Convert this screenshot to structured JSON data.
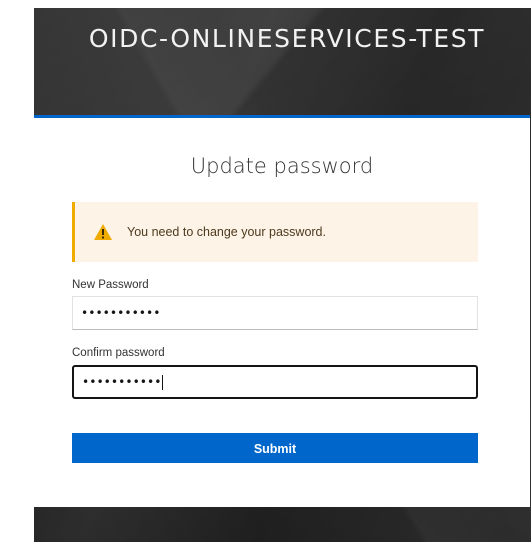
{
  "realm": {
    "title": "OIDC-ONLINESERVICES-TEST"
  },
  "card": {
    "title": "Update password",
    "accent_color": "#0066cc"
  },
  "alert": {
    "icon": "warning-triangle-icon",
    "message": "You need to change your password.",
    "color": "#f0ab00",
    "background": "#fdf3e7"
  },
  "form": {
    "new_password": {
      "label": "New Password",
      "value": "•••••••••••"
    },
    "confirm_password": {
      "label": "Confirm password",
      "value": "•••••••••••"
    },
    "submit_label": "Submit"
  }
}
